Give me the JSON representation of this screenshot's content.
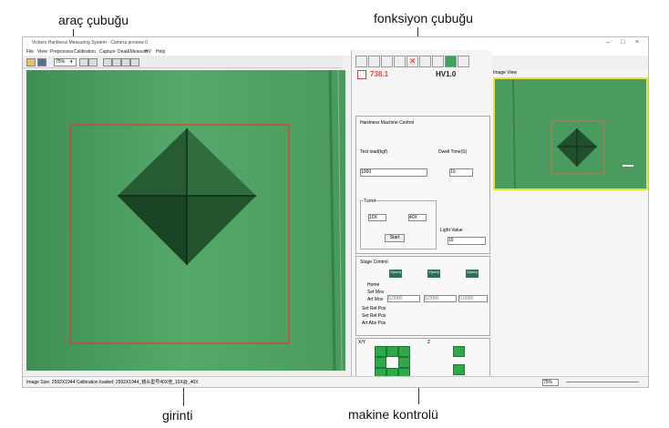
{
  "annotations": {
    "toolbar": "araç çubuğu",
    "function_bar": "fonksiyon çubuğu",
    "indentation": "girinti",
    "machine_control": "makine kontrolü"
  },
  "window": {
    "title": "Vickers Hardness Measuring System - Camera preview 0",
    "controls": [
      "–",
      "□",
      "×"
    ]
  },
  "menu": [
    "File",
    "View",
    "Preprocess",
    "Calibration",
    "Capture",
    "Deal&Measure",
    "HV",
    "Help"
  ],
  "toolbar": {
    "zoom": "75%"
  },
  "readout": {
    "value": "738.1",
    "unit": "HV1.0"
  },
  "hardness": {
    "section_title": "Hardness Machine Control",
    "test_load_label": "Test load(kgf)",
    "test_load_value": "1000",
    "dwell_label": "Dwell Time(S)",
    "dwell_value": "10",
    "turret_label": "Turret",
    "turret_left": "10X",
    "turret_right": "40X",
    "start": "Start",
    "light_label": "Light Value",
    "light_value": "15"
  },
  "stage": {
    "section_title": "Stage Control",
    "col_headers": [
      "X(mm)",
      "Y(mm)",
      "Z(mm)"
    ],
    "row_labels": [
      "Home",
      "Set Mov",
      "Art Mov",
      "Set Rel Pos",
      "Set Rel Pos",
      "Art Abs Pos"
    ],
    "values": [
      "0.0000",
      "0.0000",
      "0.0000"
    ],
    "xy_label": "X/Y",
    "z_label": "Z"
  },
  "preview": {
    "title": "Image View"
  },
  "status": {
    "text": "Image Size: 2592X1944   Calibration loaded: 2592X1944_镜头型号40X倍_10X@_40X",
    "zoom": "75%"
  }
}
